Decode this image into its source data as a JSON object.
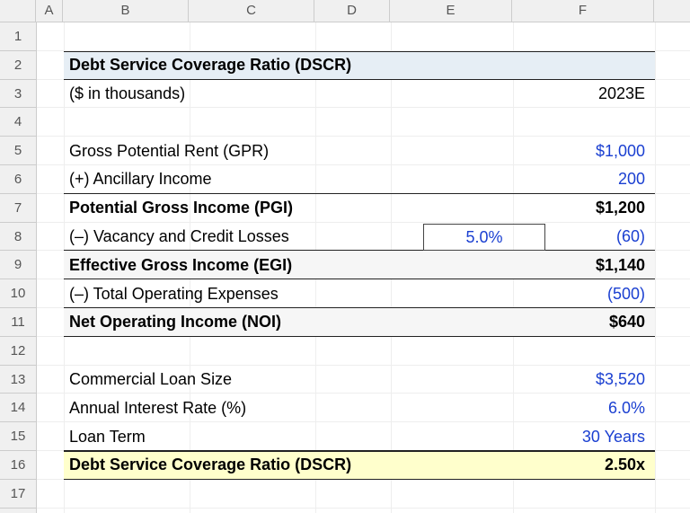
{
  "columns": [
    "A",
    "B",
    "C",
    "D",
    "E",
    "F"
  ],
  "rowCount": 17,
  "rows": {
    "2": {
      "label": "Debt Service Coverage Ratio (DSCR)",
      "bold": true,
      "style": "title"
    },
    "3": {
      "label": "($ in thousands)",
      "f": "2023E"
    },
    "5": {
      "label": "Gross Potential Rent (GPR)",
      "f": "$1,000",
      "fClass": "blue"
    },
    "6": {
      "label": "(+) Ancillary Income",
      "f": "200",
      "fClass": "blue",
      "bb": true
    },
    "7": {
      "label": "Potential Gross Income (PGI)",
      "bold": true,
      "f": "$1,200",
      "fBold": true
    },
    "8": {
      "label": "(–) Vacancy and Credit Losses",
      "e": "5.0%",
      "eClass": "blue boxE",
      "f": "(60)",
      "fClass": "blue",
      "bb": true
    },
    "9": {
      "label": "Effective Gross Income (EGI)",
      "bold": true,
      "f": "$1,140",
      "fBold": true,
      "style": "sub"
    },
    "10": {
      "label": "(–) Total Operating Expenses",
      "f": "(500)",
      "fClass": "blue",
      "bb": true
    },
    "11": {
      "label": "Net Operating Income (NOI)",
      "bold": true,
      "f": "$640",
      "fBold": true,
      "style": "sub"
    },
    "13": {
      "label": "Commercial Loan Size",
      "f": "$3,520",
      "fClass": "blue"
    },
    "14": {
      "label": "Annual Interest Rate (%)",
      "f": "6.0%",
      "fClass": "blue"
    },
    "15": {
      "label": "Loan Term",
      "f": "30 Years",
      "fClass": "blue",
      "bb": true
    },
    "16": {
      "label": "Debt Service Coverage Ratio (DSCR)",
      "bold": true,
      "f": "2.50x",
      "fBold": true,
      "style": "fin"
    }
  }
}
